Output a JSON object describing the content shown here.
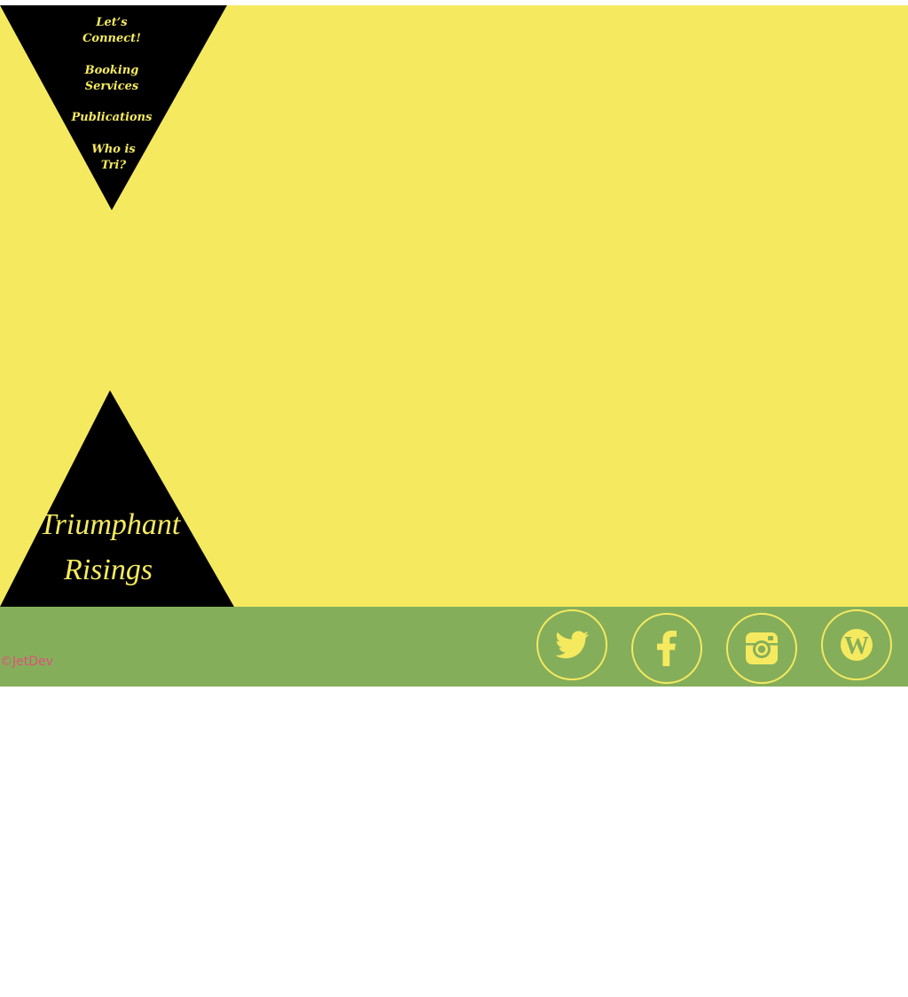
{
  "nav": {
    "items": [
      {
        "line1": "Let’s",
        "line2": "Connect!"
      },
      {
        "line1": "Booking",
        "line2": "Services"
      },
      {
        "line1": "Publications",
        "line2": ""
      },
      {
        "line1": "Who is",
        "line2": "Tri?"
      }
    ]
  },
  "logo": {
    "line1": "Triumphant",
    "line2": "Risings"
  },
  "footer": {
    "copyright": "©JetDev",
    "social": [
      {
        "name": "twitter",
        "icon": "twitter-icon"
      },
      {
        "name": "facebook",
        "icon": "facebook-icon"
      },
      {
        "name": "instagram",
        "icon": "instagram-icon"
      },
      {
        "name": "wordpress",
        "icon": "wordpress-icon"
      }
    ]
  },
  "colors": {
    "hero_bg": "#f5ea5f",
    "triangle": "#000000",
    "footer_bg": "#85ae5b",
    "accent_text": "#f5ea5f",
    "copyright": "#e0507a"
  }
}
